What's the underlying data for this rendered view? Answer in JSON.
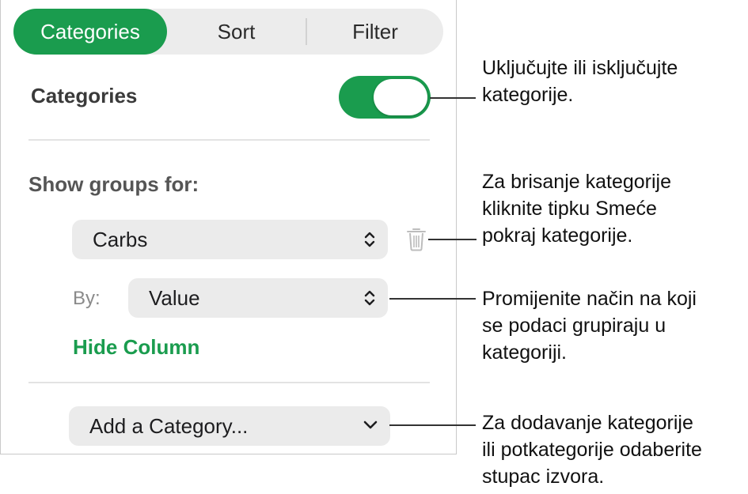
{
  "segmented_control": {
    "tabs": [
      {
        "label": "Categories",
        "selected": true
      },
      {
        "label": "Sort",
        "selected": false
      },
      {
        "label": "Filter",
        "selected": false
      }
    ]
  },
  "categories_section": {
    "label": "Categories",
    "toggle_on": true
  },
  "groups": {
    "show_groups_label": "Show groups for:",
    "column_popup_value": "Carbs",
    "by_label": "By:",
    "by_popup_value": "Value",
    "hide_column_link": "Hide Column"
  },
  "add_category": {
    "label": "Add a Category..."
  },
  "callouts": [
    {
      "text": "Uključujte ili isključujte\nkategorije."
    },
    {
      "text": "Za brisanje kategorije\nkliknite tipku Smeće\npokraj kategorije."
    },
    {
      "text": "Promijenite način na koji\nse podaci grupiraju u\nkategoriji."
    },
    {
      "text": "Za dodavanje kategorije\nili potkategorije odaberite\nstupac izvora."
    }
  ],
  "colors": {
    "accent": "#1a9c4e",
    "control_bg": "#ebebeb",
    "panel_border": "#c9c9c9"
  }
}
